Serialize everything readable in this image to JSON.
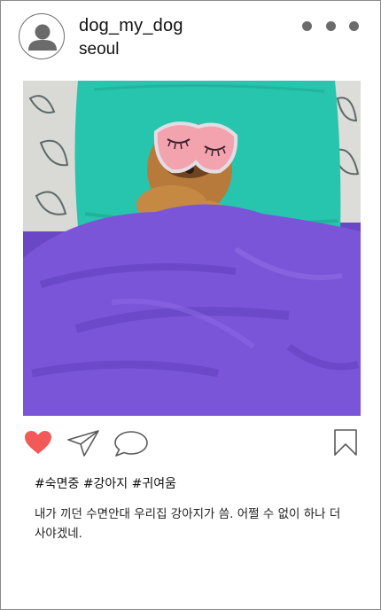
{
  "post": {
    "username": "dog_my_dog",
    "location": "seoul",
    "hashtags": "#숙면중 #강아지 #귀여움",
    "caption": "내가 끼던 수면안대 우리집 강아지가 씀. 어쩔 수 없이 하나 더 사야겠네."
  },
  "icons": {
    "avatar": "user-avatar-icon",
    "more": "more-dots-icon",
    "like": "heart-filled-icon",
    "share": "paper-plane-icon",
    "comment": "speech-bubble-icon",
    "save": "bookmark-icon"
  },
  "colors": {
    "like": "#f25a5a",
    "icon_stroke": "#5a5a5a",
    "duvet": "#7a55d8",
    "pillow": "#25c7ae",
    "mask": "#f3a3ad"
  }
}
